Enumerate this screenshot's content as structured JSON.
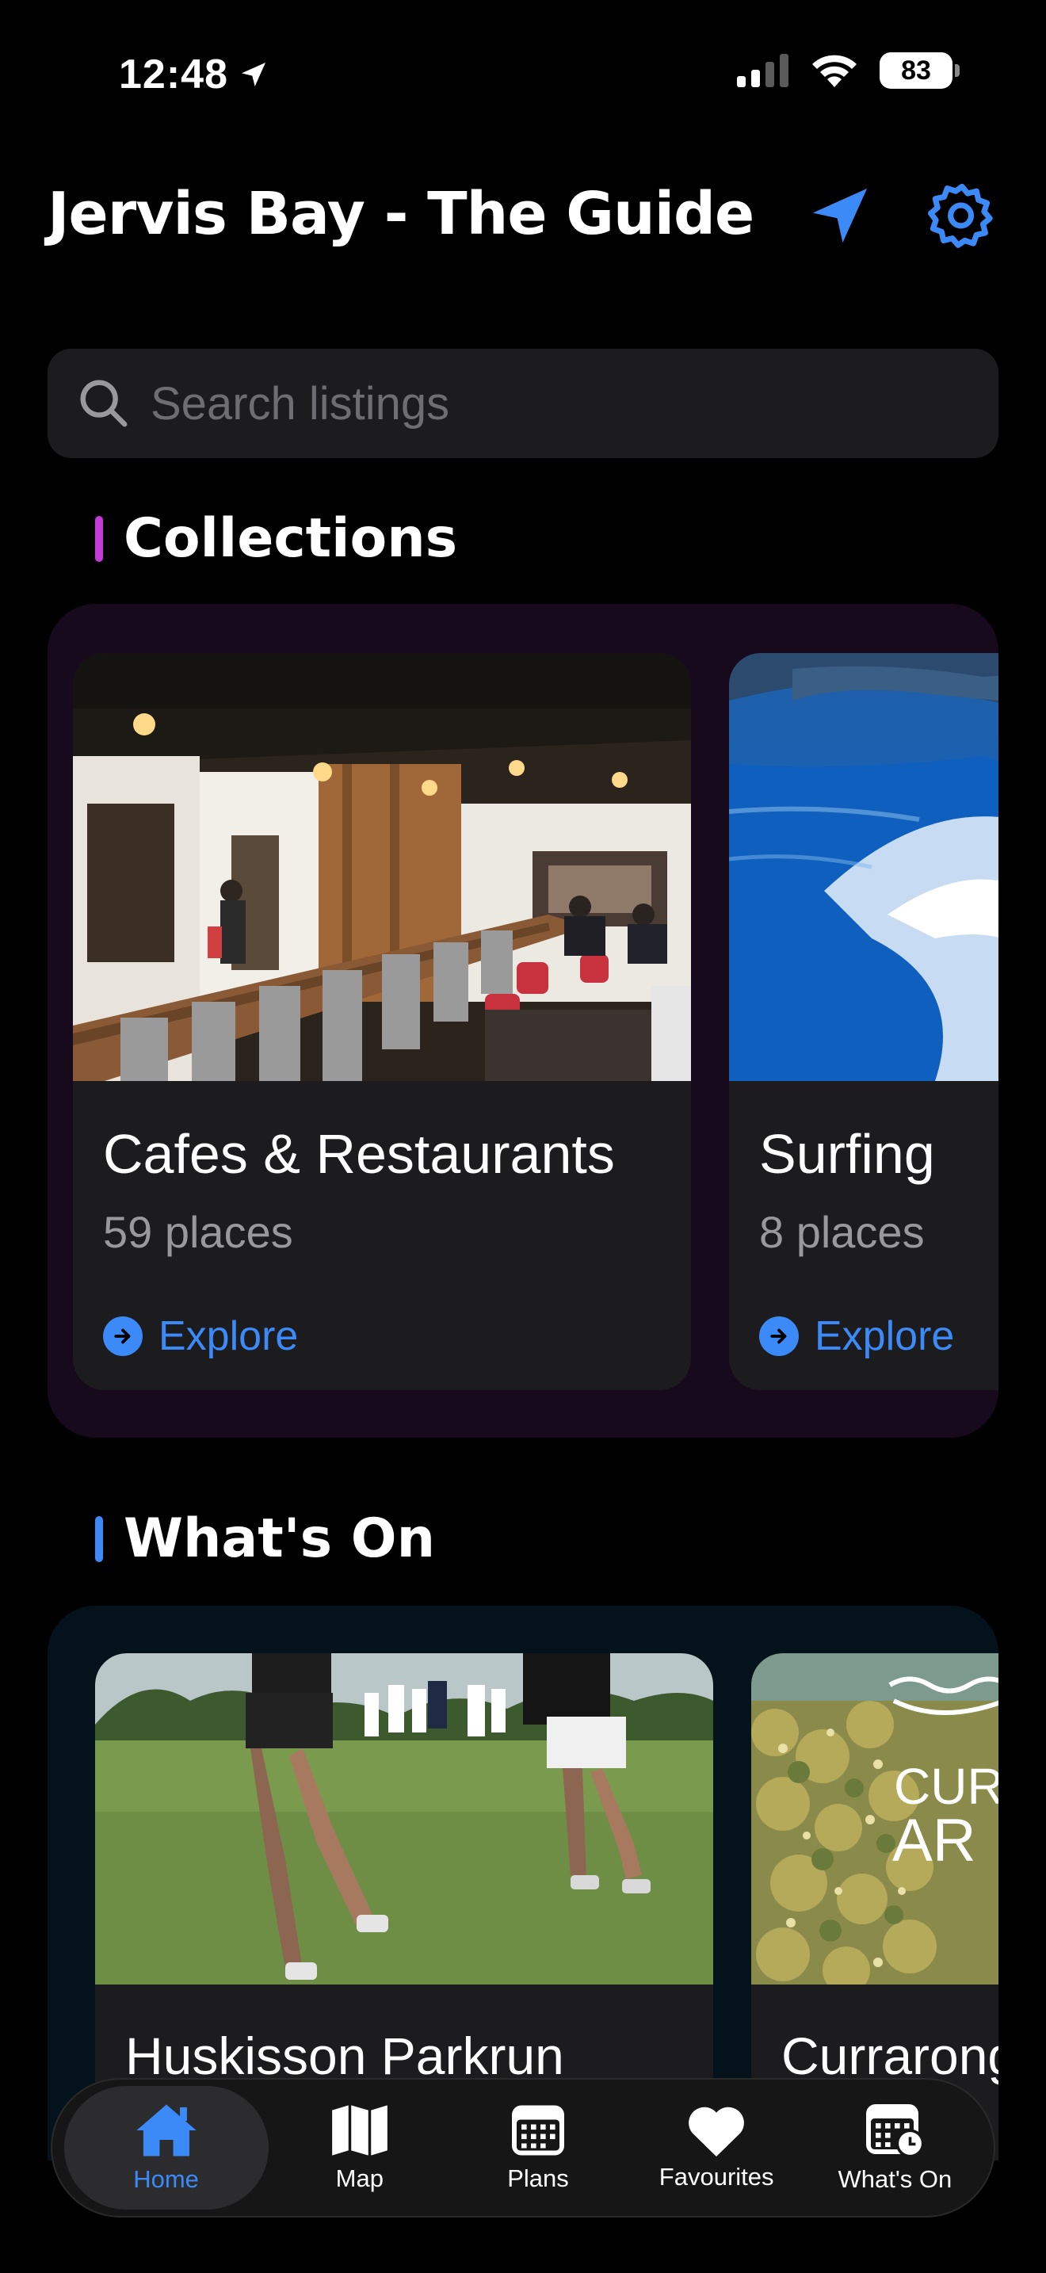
{
  "status_bar": {
    "time": "12:48",
    "battery": "83"
  },
  "header": {
    "title": "Jervis Bay - The Guide"
  },
  "search": {
    "placeholder": "Search listings"
  },
  "collections": {
    "heading": "Collections",
    "accent": "#c23bd4",
    "cards": [
      {
        "title": "Cafes & Restaurants",
        "subtitle": "59 places",
        "action": "Explore"
      },
      {
        "title": "Surfing",
        "subtitle": "8 places",
        "action": "Explore"
      }
    ]
  },
  "whats_on": {
    "heading": "What's On",
    "accent": "#3b8af7",
    "cards": [
      {
        "title": "Huskisson Parkrun"
      },
      {
        "title": "Currarong",
        "image_text_1": "CUR",
        "image_text_2": "AR"
      }
    ]
  },
  "tab_bar": {
    "tabs": [
      {
        "label": "Home",
        "icon": "house-icon",
        "active": true
      },
      {
        "label": "Map",
        "icon": "map-icon",
        "active": false
      },
      {
        "label": "Plans",
        "icon": "calendar-icon",
        "active": false
      },
      {
        "label": "Favourites",
        "icon": "heart-icon",
        "active": false
      },
      {
        "label": "What's On",
        "icon": "calendar-clock-icon",
        "active": false
      }
    ]
  },
  "colors": {
    "accent_blue": "#3b8af7",
    "background": "#000000",
    "card": "#1c1c1e"
  }
}
